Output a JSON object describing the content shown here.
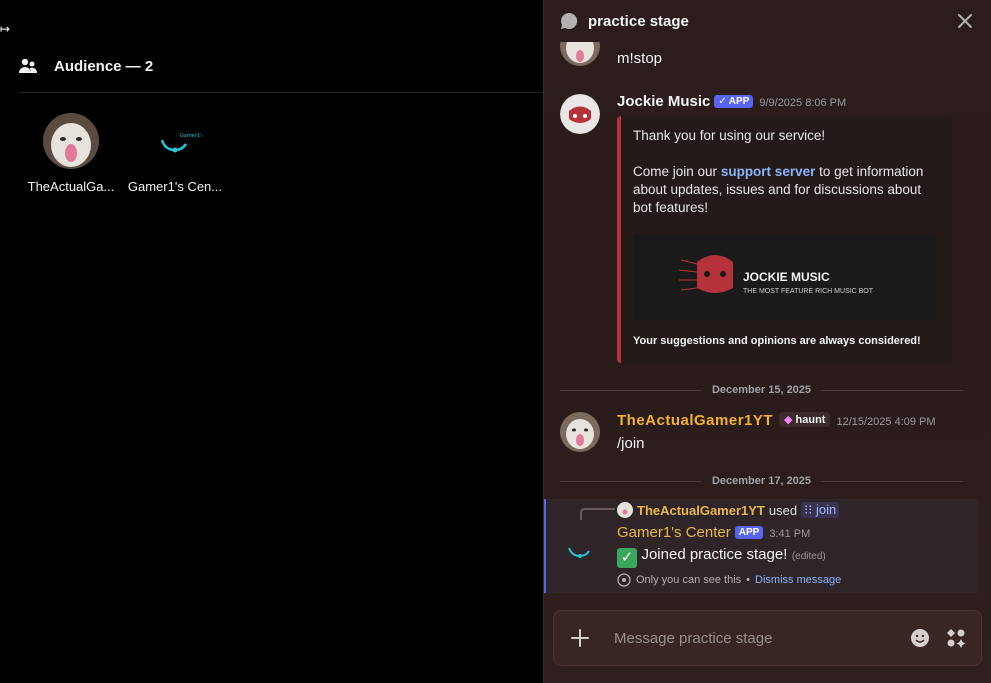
{
  "stage": {
    "audience_title": "Audience — 2",
    "members": [
      {
        "name": "TheActualGa..."
      },
      {
        "name": "Gamer1's Cen..."
      }
    ]
  },
  "chat": {
    "title": "practice stage",
    "messages": [
      {
        "text": "m!stop"
      },
      {
        "username": "Jockie Music",
        "badge": "APP",
        "timestamp": "9/9/2025 8:06 PM",
        "embed": {
          "line1": "Thank you for using our service!",
          "line2_pre": "Come join our",
          "link": "support server",
          "line2_post": "to get information about updates, issues and for discussions about bot features!",
          "banner_title": "JOCKIE MUSIC",
          "banner_subtitle": "THE MOST FEATURE RICH MUSIC BOT",
          "footer": "Your suggestions and opinions are always considered!"
        }
      },
      {
        "username": "TheActualGamer1YT",
        "tag": "haunt",
        "timestamp": "12/15/2025 4:09 PM",
        "text": "/join"
      },
      {
        "reply_user": "TheActualGamer1YT",
        "reply_used": "used",
        "reply_command": "join",
        "username": "Gamer1's Center",
        "badge": "APP",
        "timestamp": "3:41 PM",
        "text": "Joined practice stage!",
        "edited": "(edited)",
        "ephemeral_note": "Only you can see this",
        "dismiss": "Dismiss message"
      }
    ],
    "date_separators": [
      "December 15, 2025",
      "December 17, 2025"
    ],
    "composer_placeholder": "Message practice stage"
  },
  "colors": {
    "accent": "#5865f2",
    "username_gold": "#f0b232",
    "username_gamer": "#e6b84a",
    "embed_border": "#b6323a"
  }
}
